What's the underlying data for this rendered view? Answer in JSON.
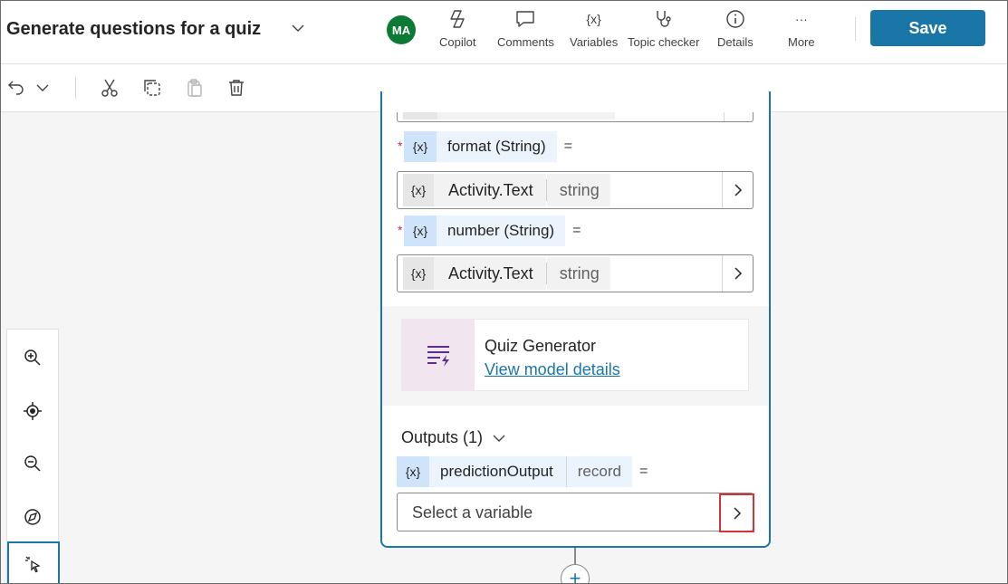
{
  "header": {
    "title": "Generate questions for a quiz",
    "avatar_initials": "MA",
    "buttons": {
      "copilot": "Copilot",
      "comments": "Comments",
      "variables": "Variables",
      "variables_glyph": "{x}",
      "topic_checker": "Topic checker",
      "details": "Details",
      "more": "More",
      "more_glyph": "···"
    },
    "save_label": "Save"
  },
  "node": {
    "inputs": [
      {
        "var_glyph": "{x}",
        "name": "format (String)",
        "eq": "=",
        "value": "Activity.Text",
        "type": "string"
      },
      {
        "var_glyph": "{x}",
        "name": "number (String)",
        "eq": "=",
        "value": "Activity.Text",
        "type": "string"
      }
    ],
    "required_mark": "*",
    "model": {
      "name": "Quiz Generator",
      "link": "View model details"
    },
    "outputs": {
      "label": "Outputs (1)",
      "var_glyph": "{x}",
      "var_name": "predictionOutput",
      "var_type": "record",
      "eq": "=",
      "select_placeholder": "Select a variable"
    },
    "add_glyph": "+"
  },
  "colors": {
    "accent": "#1b76a8",
    "avatar": "#0b7a34",
    "highlight_border": "#d13438"
  }
}
